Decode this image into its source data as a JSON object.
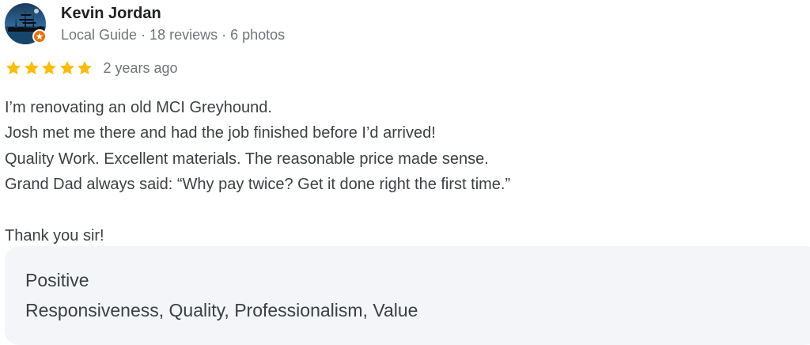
{
  "reviewer": {
    "name": "Kevin Jordan",
    "meta": "Local Guide · 18 reviews · 6 photos"
  },
  "rating": {
    "stars": 5,
    "max": 5,
    "star_color": "#fbbc04",
    "date": "2 years ago"
  },
  "review": {
    "lines": [
      "I’m renovating an old MCI Greyhound.",
      "Josh met me there and had the job finished before I’d arrived!",
      "Quality Work. Excellent materials. The reasonable price made sense.",
      "Grand Dad always said: “Why pay twice? Get it done right the first time.”",
      "",
      "Thank you sir!"
    ]
  },
  "attributes": {
    "title": "Positive",
    "values": "Responsiveness, Quality, Professionalism, Value"
  },
  "colors": {
    "badge": "#e8710a",
    "panel_bg": "#f3f5f8",
    "text_secondary": "#70757a"
  },
  "icons": {
    "avatar": "profile-photo-ship-silhouette",
    "badge": "local-guide-star-icon",
    "star": "star-icon"
  }
}
